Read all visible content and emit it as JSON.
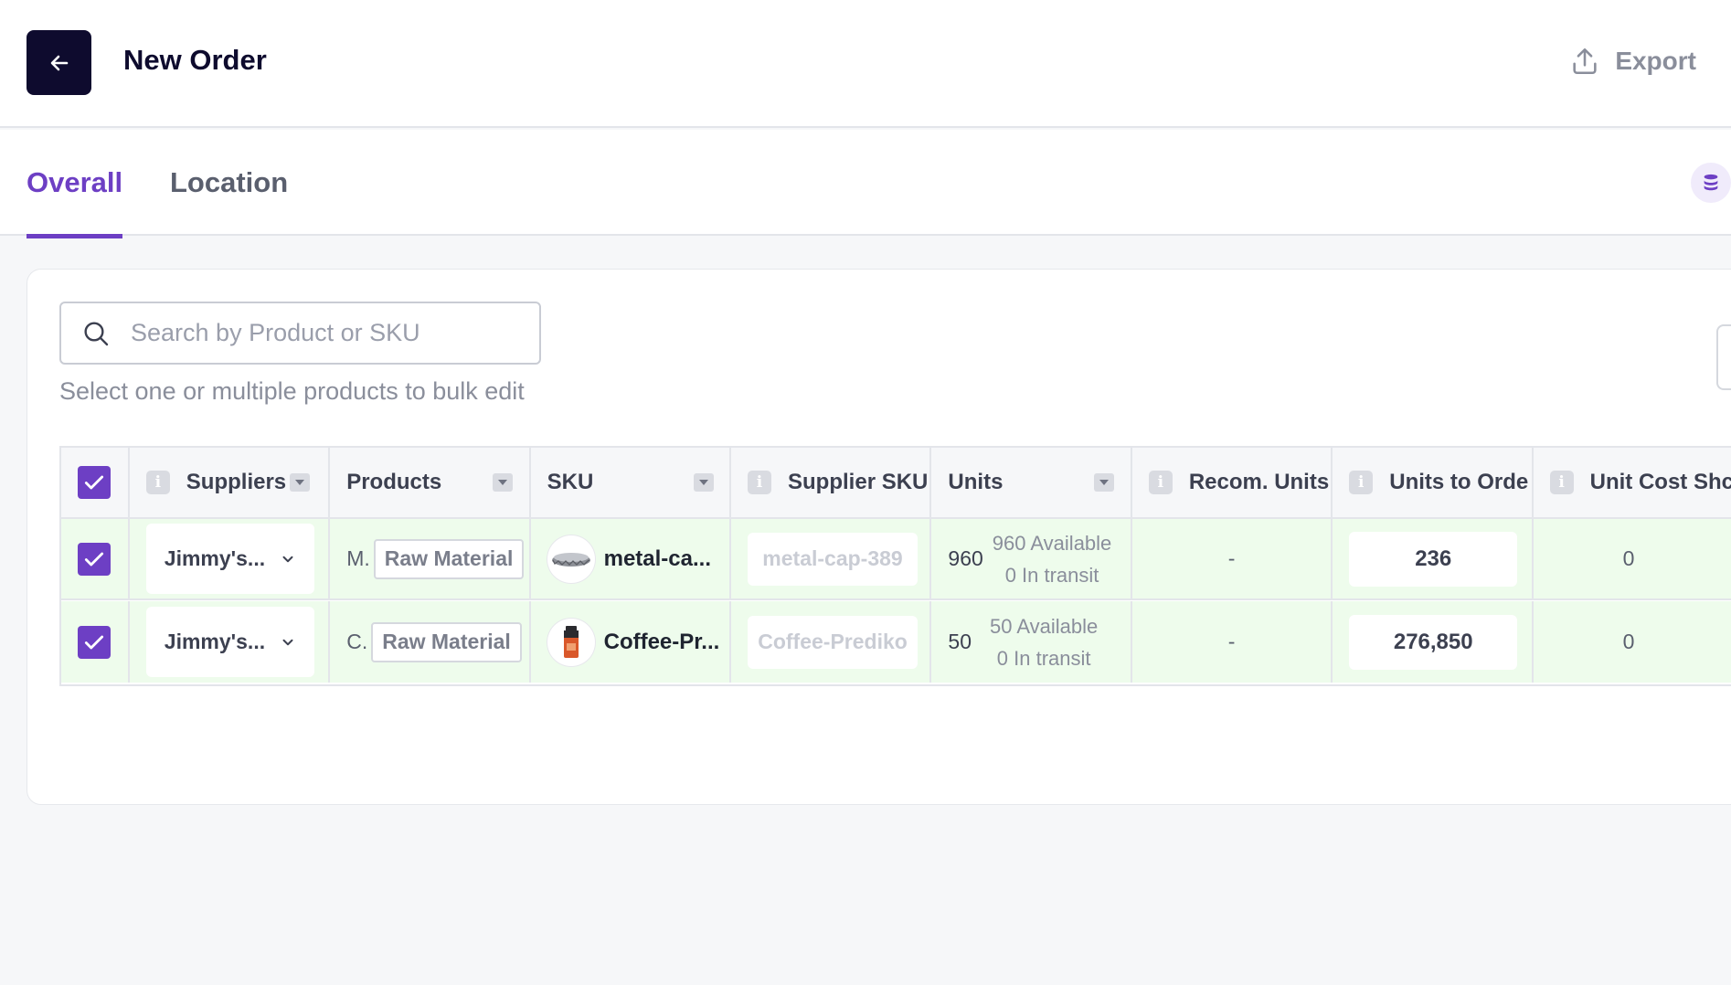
{
  "header": {
    "title": "New Order",
    "export_label": "Export"
  },
  "tabs": [
    {
      "label": "Overall",
      "active": true
    },
    {
      "label": "Location",
      "active": false
    }
  ],
  "search": {
    "placeholder": "Search by Product or SKU",
    "hint": "Select one or multiple products to bulk edit"
  },
  "table": {
    "columns": [
      "Suppliers",
      "Products",
      "SKU",
      "Supplier SKU",
      "Units",
      "Recom. Units",
      "Units to Orde",
      "Unit Cost Shc"
    ],
    "rows": [
      {
        "checked": true,
        "supplier": "Jimmy's...",
        "product_initial": "M.",
        "product_type": "Raw Material",
        "sku": "metal-ca...",
        "supplier_sku": "metal-cap-389",
        "units": "960",
        "available": "960 Available",
        "in_transit": "0 In transit",
        "recom_units": "-",
        "units_to_order": "236",
        "unit_cost": "0"
      },
      {
        "checked": true,
        "supplier": "Jimmy's...",
        "product_initial": "C.",
        "product_type": "Raw Material",
        "sku": "Coffee-Pr...",
        "supplier_sku": "Coffee-Prediko",
        "units": "50",
        "available": "50 Available",
        "in_transit": "0 In transit",
        "recom_units": "-",
        "units_to_order": "276,850",
        "unit_cost": "0"
      }
    ]
  },
  "colors": {
    "accent": "#6d3fc4",
    "dark": "#0e0b2e",
    "row_bg": "#eefcec"
  }
}
